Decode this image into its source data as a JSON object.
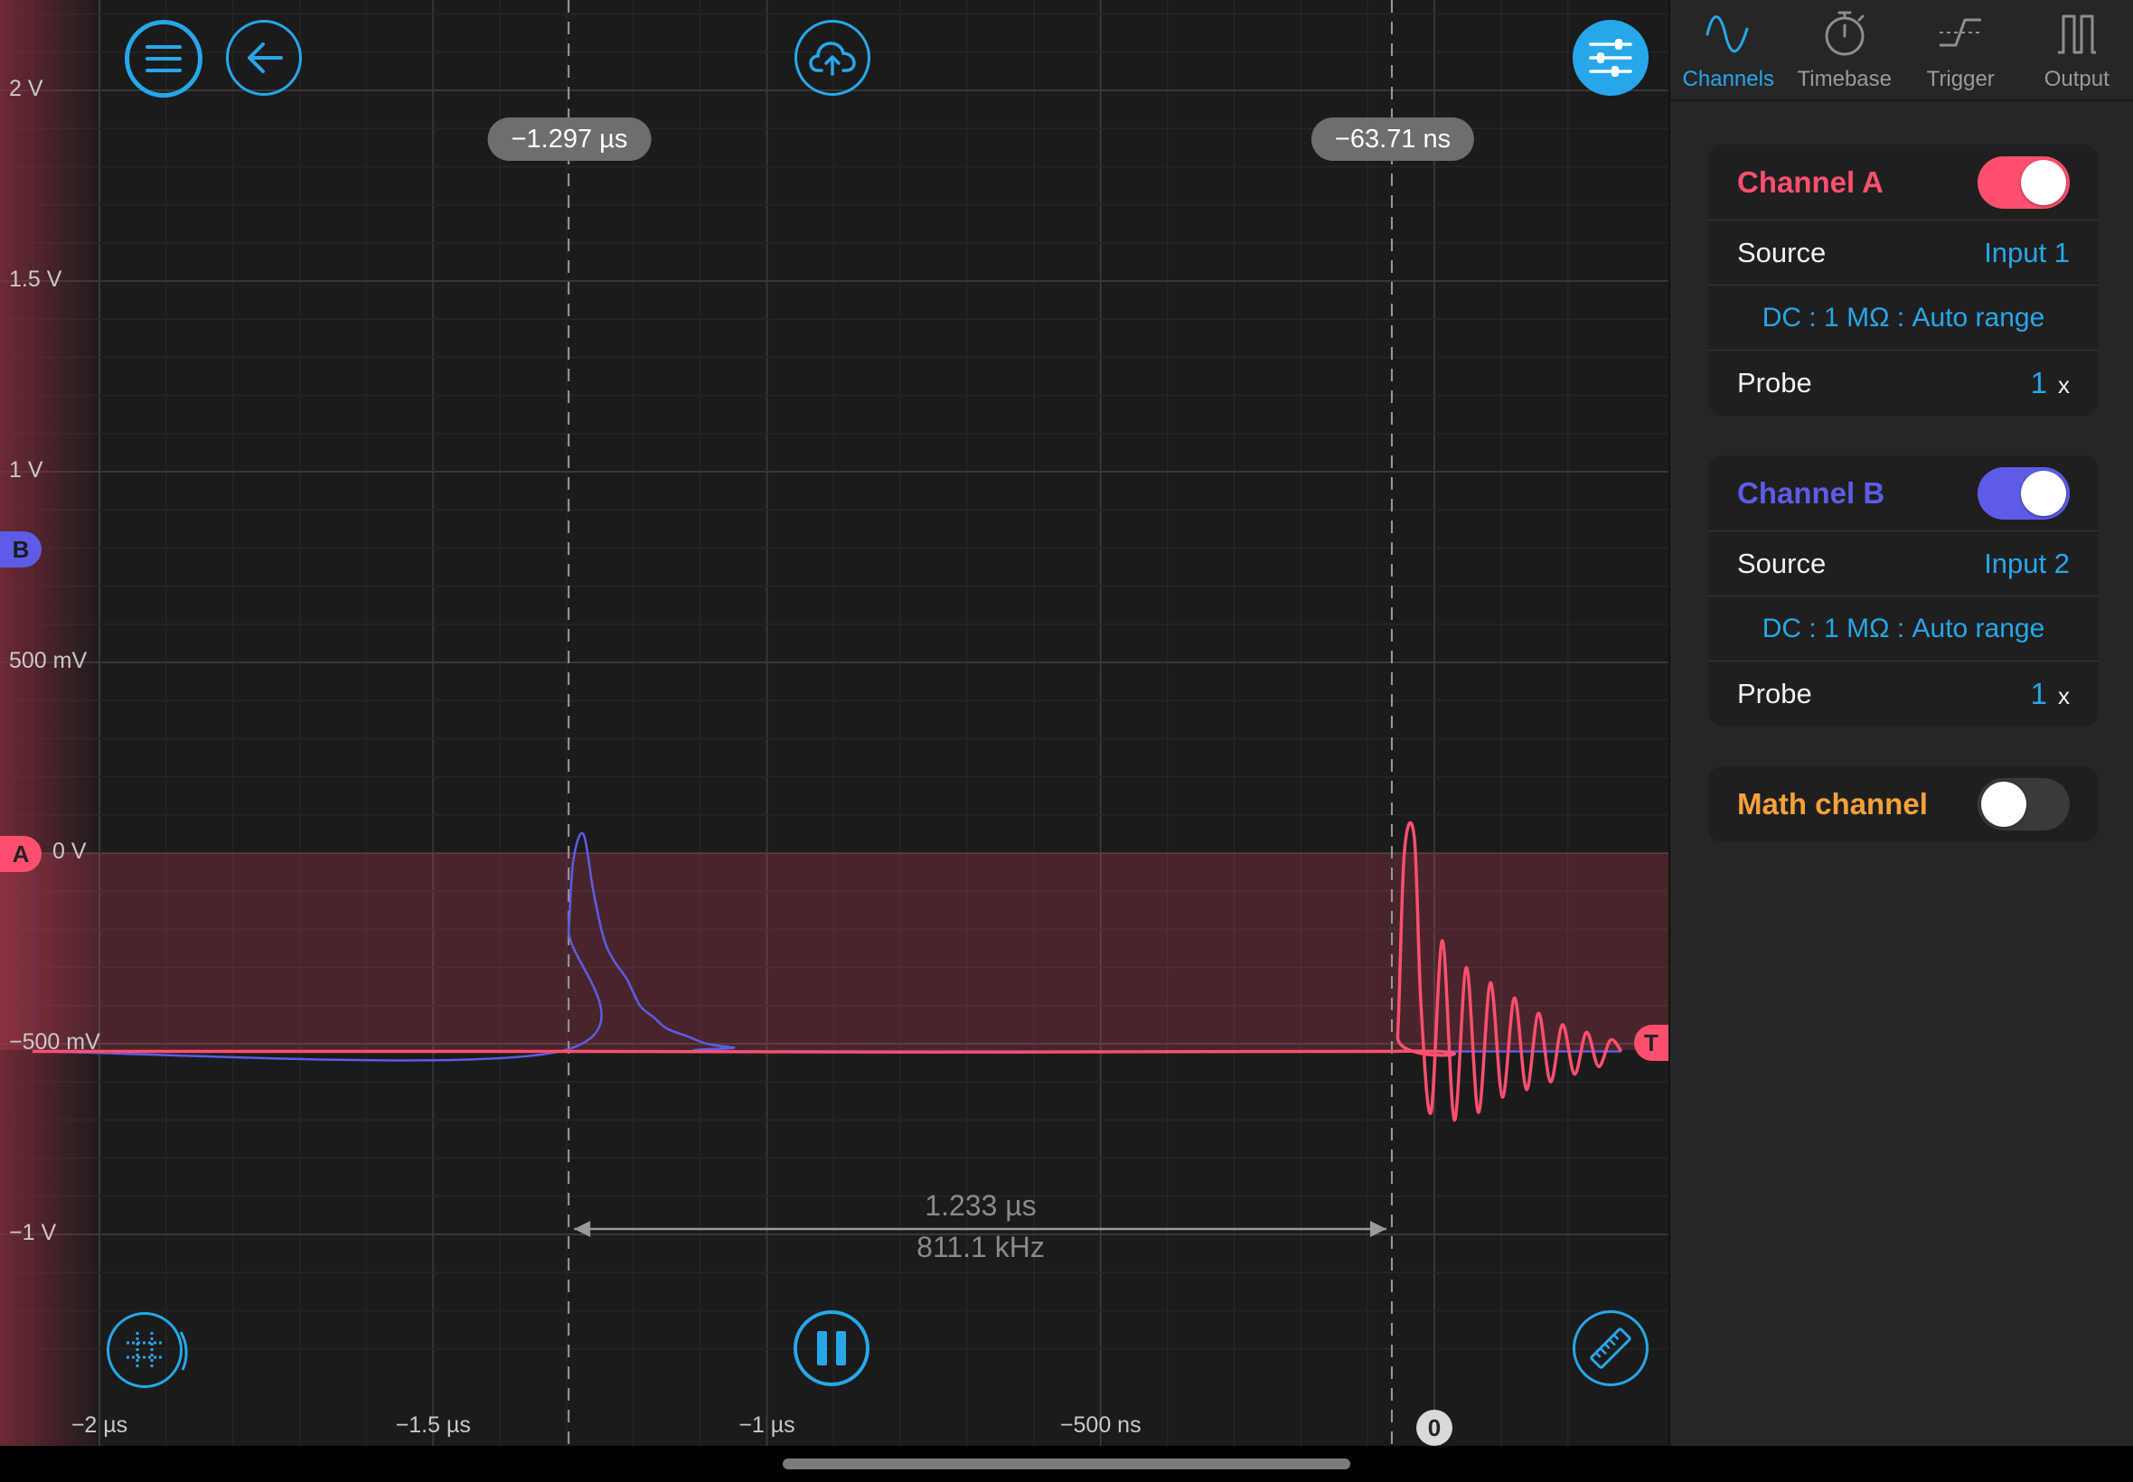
{
  "colors": {
    "accent": "#27a7ea",
    "channel_a": "#ff4f6e",
    "channel_b": "#5e5ce6",
    "math": "#f5a23a",
    "grid": "#2e2e2e"
  },
  "scope": {
    "y_labels": [
      "2 V",
      "1.5 V",
      "1 V",
      "500 mV",
      "0 V",
      "−500 mV",
      "−1 V"
    ],
    "x_labels": [
      "−2 µs",
      "−1.5 µs",
      "−1 µs",
      "−500 ns"
    ],
    "trigger_time_label": "0",
    "cursor_left_label": "−1.297 µs",
    "cursor_right_label": "−63.71 ns",
    "measure_delta": "1.233 µs",
    "measure_freq": "811.1 kHz",
    "marker_a": "A",
    "marker_b": "B",
    "marker_trigger": "T",
    "buttons": {
      "menu_icon": "hamburger-icon",
      "back_icon": "arrow-left-icon",
      "cloud_icon": "cloud-upload-icon",
      "settings_icon": "sliders-icon",
      "grid_icon": "grid-icon",
      "pause_icon": "pause-icon",
      "ruler_icon": "ruler-icon"
    }
  },
  "chart_data": {
    "type": "line",
    "x_unit": "µs",
    "y_unit": "V",
    "xlim": [
      -2.1,
      0.28
    ],
    "ylim": [
      -1.2,
      2.2
    ],
    "series": [
      {
        "name": "Channel A",
        "color": "#ff4f6e",
        "x": [
          -2.1,
          -1.3,
          -0.0637,
          -0.055,
          -0.045,
          -0.03,
          -0.02,
          -0.005,
          0.012,
          0.03,
          0.048,
          0.066,
          0.084,
          0.102,
          0.12,
          0.138,
          0.156,
          0.174,
          0.192,
          0.21,
          0.228,
          0.246,
          0.264,
          0.28
        ],
        "y": [
          -0.52,
          -0.52,
          -0.52,
          -0.48,
          0.0,
          0.04,
          -0.4,
          -0.68,
          -0.23,
          -0.7,
          -0.3,
          -0.68,
          -0.34,
          -0.64,
          -0.38,
          -0.62,
          -0.42,
          -0.6,
          -0.45,
          -0.58,
          -0.47,
          -0.56,
          -0.49,
          -0.52
        ]
      },
      {
        "name": "Channel B",
        "color": "#5e5ce6",
        "x": [
          -2.1,
          -1.31,
          -1.297,
          -1.29,
          -1.275,
          -1.26,
          -1.245,
          -1.23,
          -1.21,
          -1.19,
          -1.17,
          -1.15,
          -1.12,
          -1.09,
          -1.05,
          -1.0,
          0.28
        ],
        "y": [
          -0.52,
          -0.52,
          -0.2,
          -0.02,
          0.05,
          -0.1,
          -0.22,
          -0.28,
          -0.33,
          -0.4,
          -0.43,
          -0.46,
          -0.48,
          -0.5,
          -0.51,
          -0.52,
          -0.52
        ]
      }
    ]
  },
  "panel": {
    "tabs": [
      {
        "label": "Channels",
        "icon": "sine-wave-icon"
      },
      {
        "label": "Timebase",
        "icon": "stopwatch-icon"
      },
      {
        "label": "Trigger",
        "icon": "trigger-edge-icon"
      },
      {
        "label": "Output",
        "icon": "square-wave-icon"
      }
    ],
    "channel_a": {
      "title": "Channel A",
      "enabled": true,
      "source_label": "Source",
      "source_value": "Input 1",
      "coupling": "DC : 1 MΩ : Auto range",
      "probe_label": "Probe",
      "probe_value": "1",
      "probe_unit": "x"
    },
    "channel_b": {
      "title": "Channel B",
      "enabled": true,
      "source_label": "Source",
      "source_value": "Input 2",
      "coupling": "DC : 1 MΩ : Auto range",
      "probe_label": "Probe",
      "probe_value": "1",
      "probe_unit": "x"
    },
    "math": {
      "title": "Math channel",
      "enabled": false
    }
  }
}
